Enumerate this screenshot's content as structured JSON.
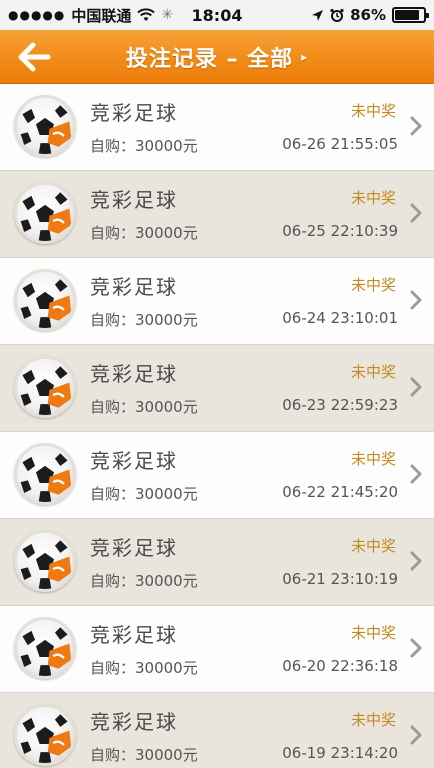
{
  "status_bar": {
    "signal": "●●●●●",
    "carrier": "中国联通",
    "time": "18:04",
    "battery_percent": "86%",
    "battery_level": 0.86
  },
  "nav": {
    "back_icon": "arrow-left-icon",
    "title": "投注记录 – 全部",
    "title_caret": "▸"
  },
  "records": [
    {
      "title": "竞彩足球",
      "status": "未中奖",
      "amount": "自购：30000元",
      "time": "06-26 21:55:05"
    },
    {
      "title": "竞彩足球",
      "status": "未中奖",
      "amount": "自购：30000元",
      "time": "06-25 22:10:39"
    },
    {
      "title": "竞彩足球",
      "status": "未中奖",
      "amount": "自购：30000元",
      "time": "06-24 23:10:01"
    },
    {
      "title": "竞彩足球",
      "status": "未中奖",
      "amount": "自购：30000元",
      "time": "06-23 22:59:23"
    },
    {
      "title": "竞彩足球",
      "status": "未中奖",
      "amount": "自购：30000元",
      "time": "06-22 21:45:20"
    },
    {
      "title": "竞彩足球",
      "status": "未中奖",
      "amount": "自购：30000元",
      "time": "06-21 23:10:19"
    },
    {
      "title": "竞彩足球",
      "status": "未中奖",
      "amount": "自购：30000元",
      "time": "06-20 22:36:18"
    },
    {
      "title": "竞彩足球",
      "status": "未中奖",
      "amount": "自购：30000元",
      "time": "06-19 23:14:20"
    }
  ],
  "colors": {
    "nav_orange": "#f28b17",
    "status_gold": "#c58a1f",
    "row_alt": "#e9e5dd"
  }
}
